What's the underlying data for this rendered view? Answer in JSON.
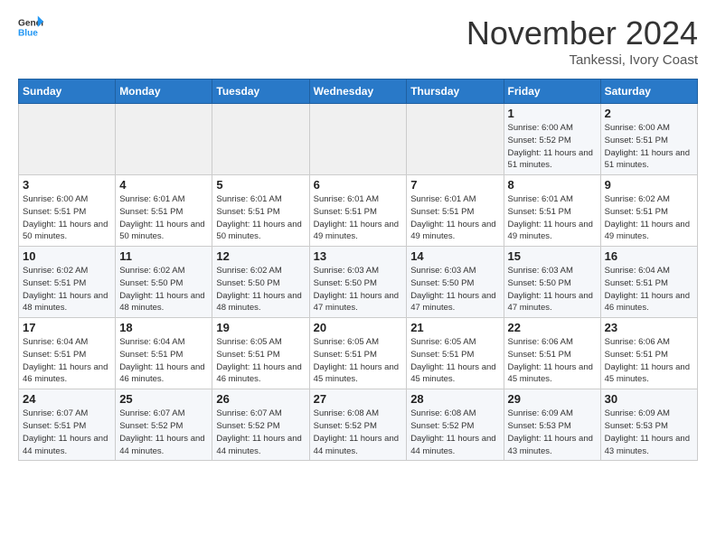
{
  "header": {
    "logo_line1": "General",
    "logo_line2": "Blue",
    "month": "November 2024",
    "location": "Tankessi, Ivory Coast"
  },
  "weekdays": [
    "Sunday",
    "Monday",
    "Tuesday",
    "Wednesday",
    "Thursday",
    "Friday",
    "Saturday"
  ],
  "weeks": [
    [
      {
        "day": "",
        "empty": true
      },
      {
        "day": "",
        "empty": true
      },
      {
        "day": "",
        "empty": true
      },
      {
        "day": "",
        "empty": true
      },
      {
        "day": "",
        "empty": true
      },
      {
        "day": "1",
        "sunrise": "Sunrise: 6:00 AM",
        "sunset": "Sunset: 5:52 PM",
        "daylight": "Daylight: 11 hours and 51 minutes."
      },
      {
        "day": "2",
        "sunrise": "Sunrise: 6:00 AM",
        "sunset": "Sunset: 5:51 PM",
        "daylight": "Daylight: 11 hours and 51 minutes."
      }
    ],
    [
      {
        "day": "3",
        "sunrise": "Sunrise: 6:00 AM",
        "sunset": "Sunset: 5:51 PM",
        "daylight": "Daylight: 11 hours and 50 minutes."
      },
      {
        "day": "4",
        "sunrise": "Sunrise: 6:01 AM",
        "sunset": "Sunset: 5:51 PM",
        "daylight": "Daylight: 11 hours and 50 minutes."
      },
      {
        "day": "5",
        "sunrise": "Sunrise: 6:01 AM",
        "sunset": "Sunset: 5:51 PM",
        "daylight": "Daylight: 11 hours and 50 minutes."
      },
      {
        "day": "6",
        "sunrise": "Sunrise: 6:01 AM",
        "sunset": "Sunset: 5:51 PM",
        "daylight": "Daylight: 11 hours and 49 minutes."
      },
      {
        "day": "7",
        "sunrise": "Sunrise: 6:01 AM",
        "sunset": "Sunset: 5:51 PM",
        "daylight": "Daylight: 11 hours and 49 minutes."
      },
      {
        "day": "8",
        "sunrise": "Sunrise: 6:01 AM",
        "sunset": "Sunset: 5:51 PM",
        "daylight": "Daylight: 11 hours and 49 minutes."
      },
      {
        "day": "9",
        "sunrise": "Sunrise: 6:02 AM",
        "sunset": "Sunset: 5:51 PM",
        "daylight": "Daylight: 11 hours and 49 minutes."
      }
    ],
    [
      {
        "day": "10",
        "sunrise": "Sunrise: 6:02 AM",
        "sunset": "Sunset: 5:51 PM",
        "daylight": "Daylight: 11 hours and 48 minutes."
      },
      {
        "day": "11",
        "sunrise": "Sunrise: 6:02 AM",
        "sunset": "Sunset: 5:50 PM",
        "daylight": "Daylight: 11 hours and 48 minutes."
      },
      {
        "day": "12",
        "sunrise": "Sunrise: 6:02 AM",
        "sunset": "Sunset: 5:50 PM",
        "daylight": "Daylight: 11 hours and 48 minutes."
      },
      {
        "day": "13",
        "sunrise": "Sunrise: 6:03 AM",
        "sunset": "Sunset: 5:50 PM",
        "daylight": "Daylight: 11 hours and 47 minutes."
      },
      {
        "day": "14",
        "sunrise": "Sunrise: 6:03 AM",
        "sunset": "Sunset: 5:50 PM",
        "daylight": "Daylight: 11 hours and 47 minutes."
      },
      {
        "day": "15",
        "sunrise": "Sunrise: 6:03 AM",
        "sunset": "Sunset: 5:50 PM",
        "daylight": "Daylight: 11 hours and 47 minutes."
      },
      {
        "day": "16",
        "sunrise": "Sunrise: 6:04 AM",
        "sunset": "Sunset: 5:51 PM",
        "daylight": "Daylight: 11 hours and 46 minutes."
      }
    ],
    [
      {
        "day": "17",
        "sunrise": "Sunrise: 6:04 AM",
        "sunset": "Sunset: 5:51 PM",
        "daylight": "Daylight: 11 hours and 46 minutes."
      },
      {
        "day": "18",
        "sunrise": "Sunrise: 6:04 AM",
        "sunset": "Sunset: 5:51 PM",
        "daylight": "Daylight: 11 hours and 46 minutes."
      },
      {
        "day": "19",
        "sunrise": "Sunrise: 6:05 AM",
        "sunset": "Sunset: 5:51 PM",
        "daylight": "Daylight: 11 hours and 46 minutes."
      },
      {
        "day": "20",
        "sunrise": "Sunrise: 6:05 AM",
        "sunset": "Sunset: 5:51 PM",
        "daylight": "Daylight: 11 hours and 45 minutes."
      },
      {
        "day": "21",
        "sunrise": "Sunrise: 6:05 AM",
        "sunset": "Sunset: 5:51 PM",
        "daylight": "Daylight: 11 hours and 45 minutes."
      },
      {
        "day": "22",
        "sunrise": "Sunrise: 6:06 AM",
        "sunset": "Sunset: 5:51 PM",
        "daylight": "Daylight: 11 hours and 45 minutes."
      },
      {
        "day": "23",
        "sunrise": "Sunrise: 6:06 AM",
        "sunset": "Sunset: 5:51 PM",
        "daylight": "Daylight: 11 hours and 45 minutes."
      }
    ],
    [
      {
        "day": "24",
        "sunrise": "Sunrise: 6:07 AM",
        "sunset": "Sunset: 5:51 PM",
        "daylight": "Daylight: 11 hours and 44 minutes."
      },
      {
        "day": "25",
        "sunrise": "Sunrise: 6:07 AM",
        "sunset": "Sunset: 5:52 PM",
        "daylight": "Daylight: 11 hours and 44 minutes."
      },
      {
        "day": "26",
        "sunrise": "Sunrise: 6:07 AM",
        "sunset": "Sunset: 5:52 PM",
        "daylight": "Daylight: 11 hours and 44 minutes."
      },
      {
        "day": "27",
        "sunrise": "Sunrise: 6:08 AM",
        "sunset": "Sunset: 5:52 PM",
        "daylight": "Daylight: 11 hours and 44 minutes."
      },
      {
        "day": "28",
        "sunrise": "Sunrise: 6:08 AM",
        "sunset": "Sunset: 5:52 PM",
        "daylight": "Daylight: 11 hours and 44 minutes."
      },
      {
        "day": "29",
        "sunrise": "Sunrise: 6:09 AM",
        "sunset": "Sunset: 5:53 PM",
        "daylight": "Daylight: 11 hours and 43 minutes."
      },
      {
        "day": "30",
        "sunrise": "Sunrise: 6:09 AM",
        "sunset": "Sunset: 5:53 PM",
        "daylight": "Daylight: 11 hours and 43 minutes."
      }
    ]
  ]
}
